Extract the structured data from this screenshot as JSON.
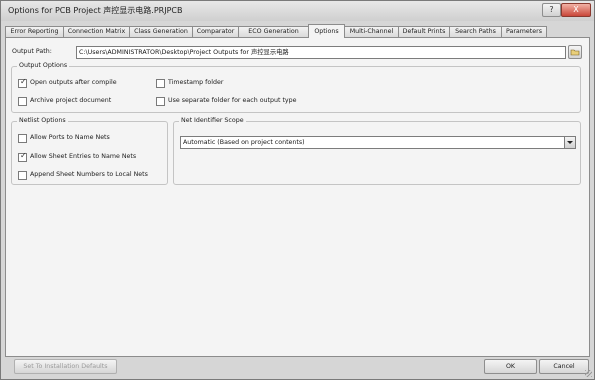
{
  "window": {
    "title": "Options for PCB Project 声控显示电路.PRJPCB",
    "help_label": "?",
    "close_label": "X"
  },
  "tabs": [
    {
      "label": "Error Reporting"
    },
    {
      "label": "Connection Matrix"
    },
    {
      "label": "Class Generation"
    },
    {
      "label": "Comparator"
    },
    {
      "label": "ECO Generation"
    },
    {
      "label": "Options"
    },
    {
      "label": "Multi-Channel"
    },
    {
      "label": "Default Prints"
    },
    {
      "label": "Search Paths"
    },
    {
      "label": "Parameters"
    }
  ],
  "active_tab": "Options",
  "output_path": {
    "label": "Output Path:",
    "value": "C:\\Users\\ADMINISTRATOR\\Desktop\\Project Outputs for 声控显示电路"
  },
  "output_options": {
    "title": "Output Options",
    "open_outputs": {
      "label": "Open outputs after compile",
      "checked": true
    },
    "timestamp_folder": {
      "label": "Timestamp folder",
      "checked": false
    },
    "archive_project": {
      "label": "Archive project document",
      "checked": false
    },
    "separate_folder": {
      "label": "Use separate folder for each output type",
      "checked": false
    }
  },
  "netlist_options": {
    "title": "Netlist Options",
    "allow_ports": {
      "label": "Allow Ports to Name Nets",
      "checked": false
    },
    "allow_sheet_entries": {
      "label": "Allow Sheet Entries to Name Nets",
      "checked": true
    },
    "append_sheet_numbers": {
      "label": "Append Sheet Numbers to Local Nets",
      "checked": false
    }
  },
  "net_identifier_scope": {
    "title": "Net Identifier Scope",
    "selected": "Automatic (Based on project contents)"
  },
  "footer": {
    "set_defaults_label": "Set To Installation Defaults",
    "ok_label": "OK",
    "cancel_label": "Cancel"
  }
}
